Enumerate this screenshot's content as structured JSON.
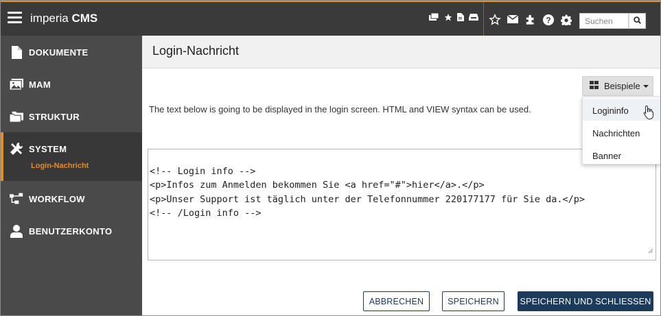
{
  "brand": {
    "light": "imperia ",
    "bold": "CMS"
  },
  "search": {
    "placeholder": "Suchen"
  },
  "sidebar": {
    "items": [
      {
        "label": "DOKUMENTE",
        "icon": "document-icon"
      },
      {
        "label": "MAM",
        "icon": "image-icon"
      },
      {
        "label": "STRUKTUR",
        "icon": "folder-icon"
      },
      {
        "label": "SYSTEM",
        "icon": "tools-icon"
      },
      {
        "label": "WORKFLOW",
        "icon": "workflow-icon"
      },
      {
        "label": "BENUTZERKONTO",
        "icon": "user-icon"
      }
    ],
    "active_sub": "Login-Nachricht"
  },
  "main": {
    "title": "Login-Nachricht",
    "description": "The text below is going to be displayed in the login screen. HTML and VIEW syntax can be used.",
    "examples_button": "Beispiele",
    "dropdown": [
      "Logininfo",
      "Nachrichten",
      "Banner"
    ],
    "editor_lines": [
      "<!-- Login info -->",
      "<p>Infos zum Anmelden bekommen Sie <a href=\"#\">hier</a>.</p>",
      "<p>Unser Support ist täglich unter der Telefonnummer 220177177 für Sie da.</p>",
      "<!-- /Login info -->"
    ]
  },
  "buttons": {
    "cancel": "ABBRECHEN",
    "save": "SPEICHERN",
    "save_close": "SPEICHERN UND SCHLIESSEN"
  },
  "colors": {
    "accent": "#e98a25",
    "topbar": "#3a3a3a",
    "sidebar": "#4a4a4a",
    "primary": "#1b3a5c"
  }
}
